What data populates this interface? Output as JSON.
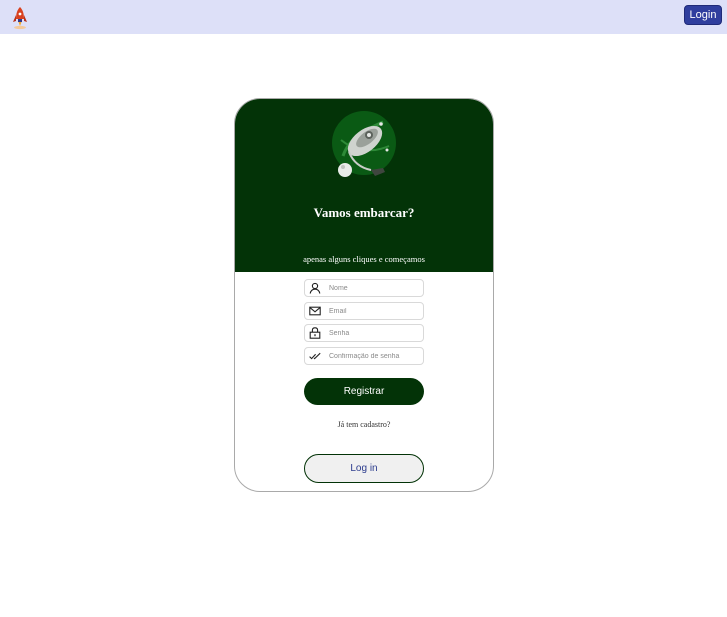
{
  "header": {
    "logo_icon": "rocket-logo-icon",
    "login_button": "Login",
    "background": "#dde0f8",
    "button_color": "#2f3e9e"
  },
  "card": {
    "hero_icon": "astronaut-illustration-icon",
    "title": "Vamos embarcar?",
    "subtitle": "apenas alguns cliques e começamos",
    "header_color": "#033307",
    "fields": [
      {
        "icon": "user-icon",
        "placeholder": "Nome",
        "value": ""
      },
      {
        "icon": "mail-icon",
        "placeholder": "Email",
        "value": ""
      },
      {
        "icon": "lock-icon",
        "placeholder": "Senha",
        "value": ""
      },
      {
        "icon": "double-check-icon",
        "placeholder": "Confirmação de senha",
        "value": ""
      }
    ],
    "register_button": "Registrar",
    "already_registered": "Já tem cadastro?",
    "login_button": "Log in"
  }
}
